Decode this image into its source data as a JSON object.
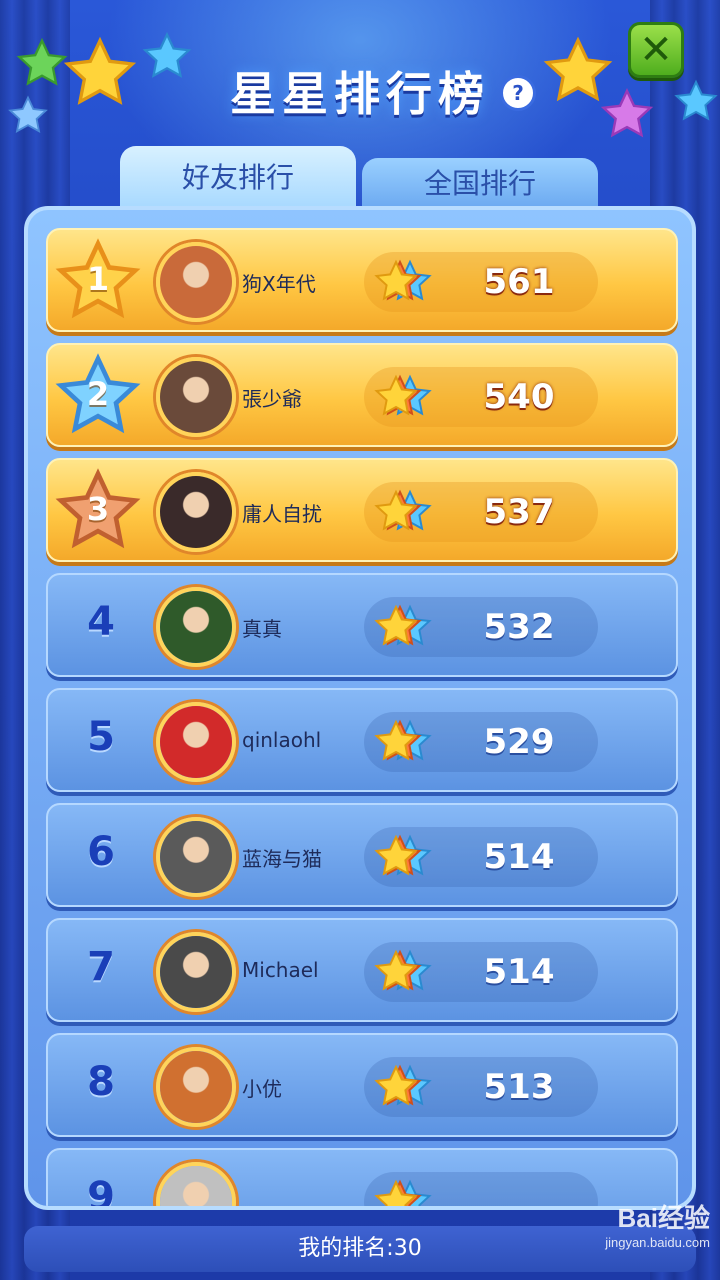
{
  "title": "星星排行榜",
  "help_label": "?",
  "close_label": "✕",
  "tabs": [
    {
      "label": "好友排行",
      "active": true
    },
    {
      "label": "全国排行",
      "active": false
    }
  ],
  "rows": [
    {
      "rank": "1",
      "name": "狗X年代",
      "score": "561",
      "style": "gold"
    },
    {
      "rank": "2",
      "name": "張少爺",
      "score": "540",
      "style": "gold"
    },
    {
      "rank": "3",
      "name": "庸人自扰",
      "score": "537",
      "style": "gold"
    },
    {
      "rank": "4",
      "name": "真真",
      "score": "532",
      "style": "blue"
    },
    {
      "rank": "5",
      "name": "qinlaohl",
      "score": "529",
      "style": "blue"
    },
    {
      "rank": "6",
      "name": "蓝海与猫",
      "score": "514",
      "style": "blue"
    },
    {
      "rank": "7",
      "name": "Michael",
      "score": "514",
      "style": "blue"
    },
    {
      "rank": "8",
      "name": "小优",
      "score": "513",
      "style": "blue"
    },
    {
      "rank": "9",
      "name": "",
      "score": "",
      "style": "blue"
    }
  ],
  "footer": {
    "my_rank": "我的排名:30"
  },
  "watermark": {
    "brand": "Bai经验",
    "url": "jingyan.baidu.com"
  },
  "colors": {
    "gold_row": "#ffc743",
    "blue_row": "#5c93e2",
    "close_green": "#4fae1e"
  },
  "icons": {
    "medal": "star-medal-icon",
    "score": "star-score-icon",
    "close": "close-icon",
    "help": "help-icon"
  }
}
